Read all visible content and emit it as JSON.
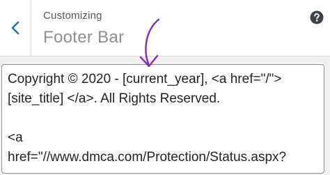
{
  "header": {
    "context_label": "Customizing",
    "section_title": "Footer Bar",
    "back_icon": "chevron-left-icon",
    "help_icon": "question-mark-icon"
  },
  "editor": {
    "line_1": "Copyright © 2020 - [current_year], <a href=\"/\">",
    "line_2": "[site_title] </a>. All Rights Reserved.",
    "line_3": "",
    "line_4": "<a",
    "line_5": "href=\"//www.dmca.com/Protection/Status.aspx?"
  },
  "annotation": {
    "icon": "hand-drawn-arrow-icon",
    "color": "#8a2bbf"
  },
  "colors": {
    "accent": "#2271b1",
    "header_background": "#ffffff",
    "page_background": "#f1f1f1",
    "muted_text": "#8c8f94"
  }
}
